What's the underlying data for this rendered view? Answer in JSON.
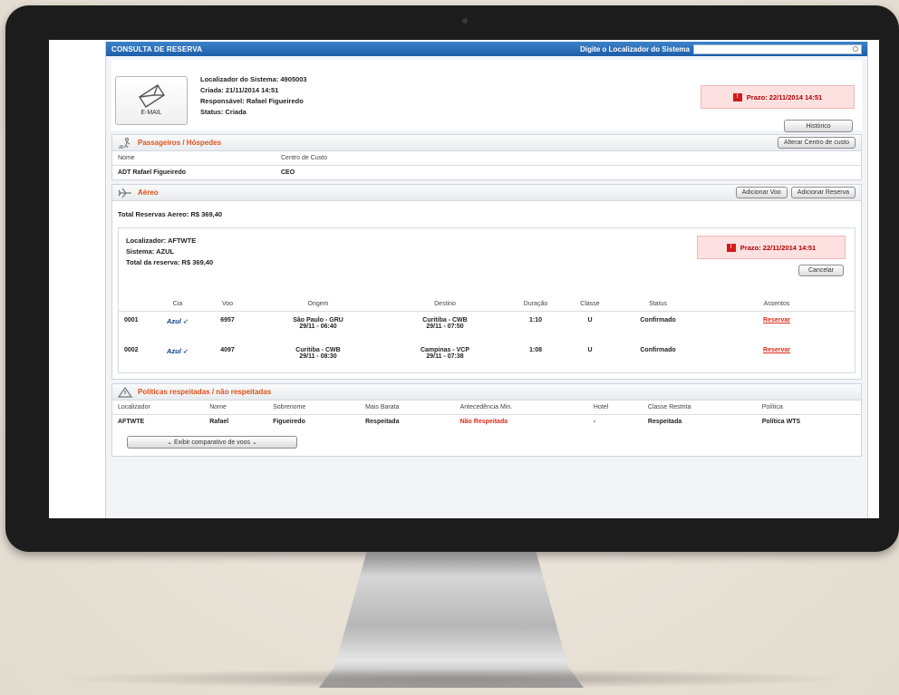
{
  "topbar": {
    "title": "CONSULTA DE RESERVA",
    "search_label": "Digite o Localizador do Sistema",
    "search_value": ""
  },
  "header": {
    "email_label": "E-MAIL",
    "localizador": "Localizador do Sistema: 4905003",
    "criada": "Criada: 21/11/2014 14:51",
    "responsavel": "Responsável: Rafael Figueiredo",
    "status": "Status: Criada",
    "prazo": "Prazo: 22/11/2014 14:51",
    "historico_label": "Histórico"
  },
  "passageiros": {
    "title": "Passageiros / Hóspedes",
    "alterar_label": "Alterar Centro de custo",
    "columns": [
      "Nome",
      "Centro de Custo"
    ],
    "rows": [
      [
        "ADT Rafael Figueiredo",
        "CEO"
      ]
    ]
  },
  "aereo": {
    "title": "Aéreo",
    "adicionar_voo_label": "Adicionar Voo",
    "adicionar_reserva_label": "Adicionar Reserva",
    "total": "Total Reservas Aereo: R$ 369,40",
    "localizador": "Localizador: AFTWTE",
    "sistema": "Sistema: AZUL",
    "total_reserva": "Total da reserva: R$ 369,40",
    "prazo": "Prazo: 22/11/2014 14:51",
    "cancelar_label": "Cancelar",
    "columns": [
      "",
      "Cia",
      "Voo",
      "Origem",
      "Destino",
      "Duração",
      "Classe",
      "Status",
      "Assentos"
    ],
    "flights": [
      {
        "seq": "0001",
        "cia": "Azul",
        "voo": "6957",
        "origem_cidade": "São Paulo - GRU",
        "origem_hora": "29/11 - 06:40",
        "destino_cidade": "Curitiba - CWB",
        "destino_hora": "29/11 - 07:50",
        "duracao": "1:10",
        "classe": "U",
        "status": "Confirmado",
        "assentos": "Reservar"
      },
      {
        "seq": "0002",
        "cia": "Azul",
        "voo": "4097",
        "origem_cidade": "Curitiba - CWB",
        "origem_hora": "29/11 - 08:30",
        "destino_cidade": "Campinas - VCP",
        "destino_hora": "29/11 - 07:38",
        "duracao": "1:08",
        "classe": "U",
        "status": "Confirmado",
        "assentos": "Reservar"
      }
    ]
  },
  "politicas": {
    "title": "Políticas respeitadas / não respeitadas",
    "columns": [
      "Localizador",
      "Nome",
      "Sobrenome",
      "Mais Barata",
      "Antecedência Min.",
      "Hotel",
      "Classe Restrita",
      "Política"
    ],
    "rows": [
      {
        "localizador": "AFTWTE",
        "nome": "Rafael",
        "sobrenome": "Figueiredo",
        "mais_barata": "Respeitada",
        "antecedencia": "Não Respeitada",
        "hotel": "-",
        "classe_restrita": "Respeitada",
        "politica": "Política WTS"
      }
    ],
    "exibir_label": "Exibir comparativo de voos"
  },
  "colors": {
    "accent": "#1d5da8",
    "alert": "#e0281a",
    "section_title": "#e0501a"
  }
}
